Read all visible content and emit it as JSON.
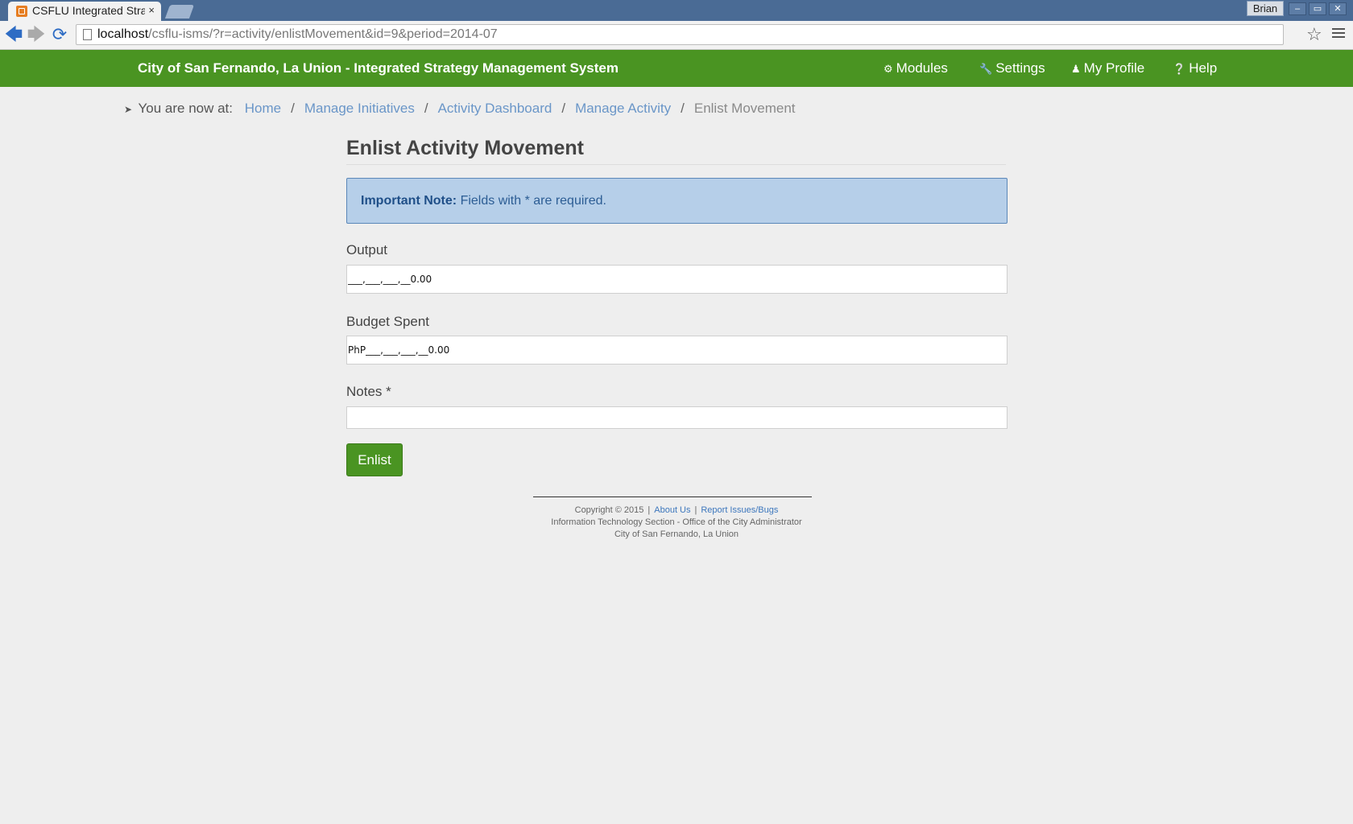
{
  "browser": {
    "tab_title": "CSFLU Integrated Strat",
    "tab_close": "×",
    "user": "Brian",
    "window_buttons": [
      "–",
      "▭",
      "✕"
    ],
    "url_host": "localhost",
    "url_path": "/csflu-isms/?r=activity/enlistMovement&id=9&period=2014-07"
  },
  "navbar": {
    "brand": "City of San Fernando, La Union - Integrated Strategy Management System",
    "items": [
      {
        "label": "Modules",
        "icon": "gears-icon"
      },
      {
        "label": "Settings",
        "icon": "wrench-icon"
      },
      {
        "label": "My Profile",
        "icon": "user-icon"
      },
      {
        "label": "Help",
        "icon": "question-circle-icon"
      }
    ]
  },
  "breadcrumb": {
    "prefix": "You are now at:",
    "links": [
      "Home",
      "Manage Initiatives",
      "Activity Dashboard",
      "Manage Activity"
    ],
    "current": "Enlist Movement"
  },
  "form": {
    "title": "Enlist Activity Movement",
    "note_strong": "Important Note:",
    "note_text": "Fields with * are required.",
    "output_label": "Output",
    "output_value": "___,___,___,__0.00",
    "budget_label": "Budget Spent",
    "budget_value": "PhP___,___,___,__0.00",
    "notes_label": "Notes *",
    "notes_value": "",
    "submit_label": "Enlist"
  },
  "footer": {
    "copyright": "Copyright © 2015",
    "about": "About Us",
    "report": "Report Issues/Bugs",
    "line2": "Information Technology Section - Office of the City Administrator",
    "line3": "City of San Fernando, La Union"
  },
  "colors": {
    "navbar_green": "#4a9422",
    "alert_bg": "#b6cfe9",
    "link_blue": "#6a96c8",
    "chrome_blue": "#4a6b95"
  }
}
